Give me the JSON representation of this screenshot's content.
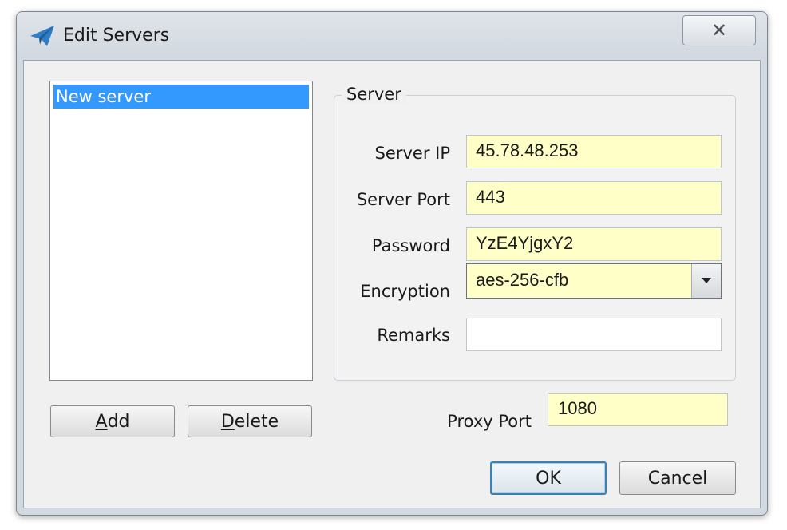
{
  "window": {
    "title": "Edit Servers",
    "icon": "paper-plane-icon",
    "close_icon": "close-icon",
    "close_glyph": "✕"
  },
  "server_list": {
    "items": [
      "New server"
    ],
    "selected_index": 0
  },
  "buttons": {
    "add_prefix": "",
    "add_mnemonic": "A",
    "add_rest": "dd",
    "delete_mnemonic": "D",
    "delete_rest": "elete",
    "ok": "OK",
    "cancel": "Cancel"
  },
  "server_group": {
    "title": "Server",
    "server_ip_label": "Server IP",
    "server_ip_value": "45.78.48.253",
    "server_port_label": "Server Port",
    "server_port_value": "443",
    "password_label": "Password",
    "password_value": "YzE4YjgxY2",
    "encryption_label": "Encryption",
    "encryption_value": "aes-256-cfb",
    "remarks_label": "Remarks",
    "remarks_value": ""
  },
  "proxy": {
    "label": "Proxy Port",
    "value": "1080"
  },
  "colors": {
    "selection": "#3399ff",
    "input_highlight": "#ffffc8",
    "window_frame": "#d3d9e1",
    "dialog_bg": "#f0f0f0"
  }
}
